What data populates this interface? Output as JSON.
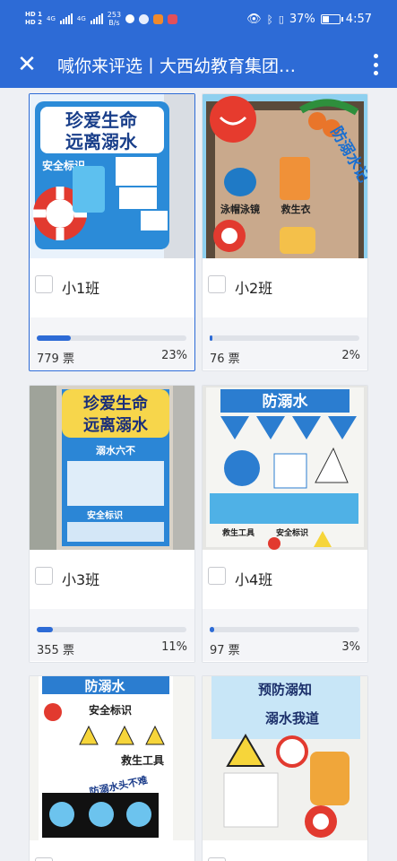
{
  "status_bar": {
    "hd1": "HD 1",
    "hd2": "HD 2",
    "net1": "4G",
    "net2": "4G",
    "speed": "253",
    "speed_unit": "B/s",
    "battery": "37%",
    "time": "4:57"
  },
  "nav": {
    "title": "喊你来评选丨大西幼教育集团…",
    "close_icon": "close-icon",
    "more_icon": "more-vertical-icon"
  },
  "theme": {
    "accent": "#2d6bd6",
    "track": "#dfe2e8"
  },
  "entries": [
    {
      "name": "小1班",
      "votes": "779 票",
      "percent": "23%",
      "progress": 0.23,
      "selected": true,
      "poster_text": [
        "珍爱生命",
        "远离溺水",
        "安全标识"
      ]
    },
    {
      "name": "小2班",
      "votes": "76 票",
      "percent": "2%",
      "progress": 0.02,
      "selected": false,
      "poster_text": [
        "防溺水记",
        "泳帽泳镜",
        "救生衣"
      ]
    },
    {
      "name": "小3班",
      "votes": "355 票",
      "percent": "11%",
      "progress": 0.11,
      "selected": false,
      "poster_text": [
        "珍爱生命",
        "远离溺水",
        "溺水六不",
        "安全标识"
      ]
    },
    {
      "name": "小4班",
      "votes": "97 票",
      "percent": "3%",
      "progress": 0.03,
      "selected": false,
      "poster_text": [
        "防溺水",
        "救生工具",
        "安全标识"
      ]
    },
    {
      "name": "",
      "votes": "",
      "percent": "",
      "selected": false,
      "poster_text": [
        "防溺水",
        "安全标识",
        "救生工具",
        "防溺水头不难"
      ]
    },
    {
      "name": "",
      "votes": "",
      "percent": "",
      "selected": false,
      "poster_text": [
        "预防溺知",
        "溺水我道"
      ]
    }
  ]
}
